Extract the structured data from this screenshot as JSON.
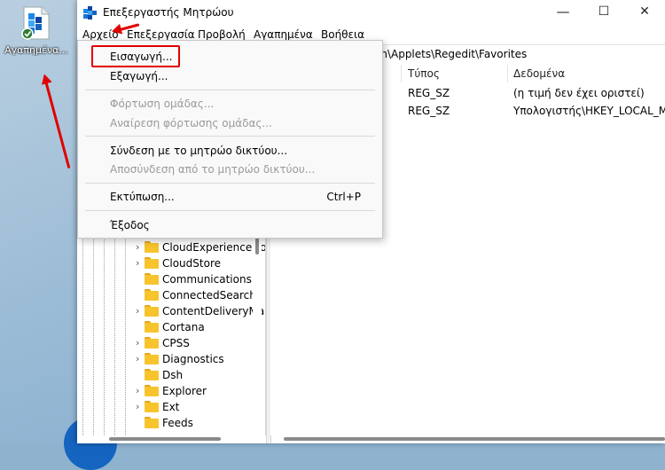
{
  "desktop": {
    "icon_label": "Αγαπημένα..."
  },
  "window": {
    "title": "Επεξεργαστής Μητρώου",
    "controls": {
      "minimize": "—",
      "maximize": "☐",
      "close": "✕"
    }
  },
  "menubar": [
    "Αρχείο",
    "Επεξεργασία",
    "Προβολή",
    "Αγαπημένα",
    "Βοήθεια"
  ],
  "address": "on\\Applets\\Regedit\\Favorites",
  "file_menu": {
    "import": "Εισαγωγή...",
    "export": "Εξαγωγή...",
    "load_hive": "Φόρτωση ομάδας...",
    "unload_hive": "Αναίρεση φόρτωσης ομάδας...",
    "connect_network": "Σύνδεση με το μητρώο δικτύου...",
    "disconnect_network": "Αποσύνδεση από το μητρώο δικτύου...",
    "print": "Εκτύπωση...",
    "print_shortcut": "Ctrl+P",
    "exit": "Έξοδος"
  },
  "tree": [
    {
      "label": "CloudExperienceHo",
      "expandable": true
    },
    {
      "label": "CloudStore",
      "expandable": true
    },
    {
      "label": "Communications",
      "expandable": false
    },
    {
      "label": "ConnectedSearch",
      "expandable": false
    },
    {
      "label": "ContentDeliveryMa",
      "expandable": true
    },
    {
      "label": "Cortana",
      "expandable": false
    },
    {
      "label": "CPSS",
      "expandable": true
    },
    {
      "label": "Diagnostics",
      "expandable": true
    },
    {
      "label": "Dsh",
      "expandable": false
    },
    {
      "label": "Explorer",
      "expandable": true
    },
    {
      "label": "Ext",
      "expandable": true
    },
    {
      "label": "Feeds",
      "expandable": false
    }
  ],
  "list": {
    "headers": {
      "type": "Τύπος",
      "data": "Δεδομένα"
    },
    "rows": [
      {
        "type": "REG_SZ",
        "data": "(η τιμή δεν έχει οριστεί)"
      },
      {
        "type": "REG_SZ",
        "data": "Υπολογιστής\\HKEY_LOCAL_MA"
      }
    ]
  },
  "colors": {
    "annotation": "#e00000",
    "folder": "#f8c42d"
  },
  "icons": [
    "regedit-icon",
    "folder-icon",
    "chevron-right-icon",
    "minimize-icon",
    "maximize-icon",
    "close-icon"
  ]
}
